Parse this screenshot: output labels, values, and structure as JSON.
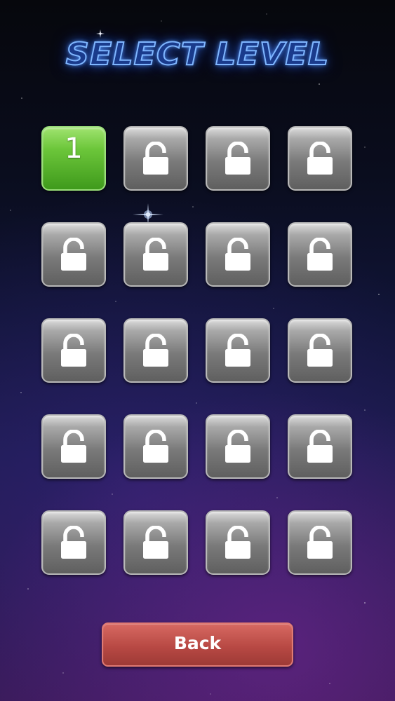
{
  "screen": {
    "title": "SELECT LEVEL"
  },
  "levels": [
    {
      "label": "1",
      "state": "unlocked"
    },
    {
      "label": "",
      "state": "locked"
    },
    {
      "label": "",
      "state": "locked"
    },
    {
      "label": "",
      "state": "locked"
    },
    {
      "label": "",
      "state": "locked"
    },
    {
      "label": "",
      "state": "locked"
    },
    {
      "label": "",
      "state": "locked"
    },
    {
      "label": "",
      "state": "locked"
    },
    {
      "label": "",
      "state": "locked"
    },
    {
      "label": "",
      "state": "locked"
    },
    {
      "label": "",
      "state": "locked"
    },
    {
      "label": "",
      "state": "locked"
    },
    {
      "label": "",
      "state": "locked"
    },
    {
      "label": "",
      "state": "locked"
    },
    {
      "label": "",
      "state": "locked"
    },
    {
      "label": "",
      "state": "locked"
    },
    {
      "label": "",
      "state": "locked"
    },
    {
      "label": "",
      "state": "locked"
    },
    {
      "label": "",
      "state": "locked"
    },
    {
      "label": "",
      "state": "locked"
    }
  ],
  "icons": {
    "locked": "padlock-icon"
  },
  "buttons": {
    "back_label": "Back"
  },
  "colors": {
    "unlocked": "#5fb832",
    "locked": "#8a8a8a",
    "back": "#c0504b",
    "title_glow": "#6aa8ff"
  }
}
